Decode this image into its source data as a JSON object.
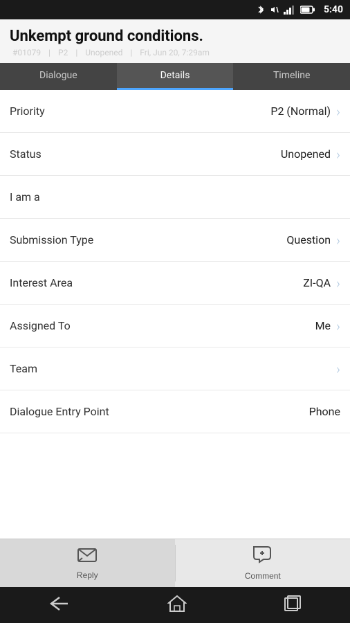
{
  "statusBar": {
    "time": "5:40"
  },
  "header": {
    "title": "Unkempt ground conditions.",
    "id": "#01079",
    "priority": "P2",
    "status": "Unopened",
    "date": "Fri, Jun 20, 7:29am"
  },
  "tabs": [
    {
      "id": "dialogue",
      "label": "Dialogue",
      "active": false
    },
    {
      "id": "details",
      "label": "Details",
      "active": true
    },
    {
      "id": "timeline",
      "label": "Timeline",
      "active": false
    }
  ],
  "details": [
    {
      "id": "priority",
      "label": "Priority",
      "value": "P2 (Normal)",
      "hasChevron": true
    },
    {
      "id": "status",
      "label": "Status",
      "value": "Unopened",
      "hasChevron": true
    },
    {
      "id": "i-am-a",
      "label": "I am a",
      "value": "",
      "hasChevron": false
    },
    {
      "id": "submission-type",
      "label": "Submission Type",
      "value": "Question",
      "hasChevron": true
    },
    {
      "id": "interest-area",
      "label": "Interest Area",
      "value": "ZI-QA",
      "hasChevron": true
    },
    {
      "id": "assigned-to",
      "label": "Assigned To",
      "value": "Me",
      "hasChevron": true
    },
    {
      "id": "team",
      "label": "Team",
      "value": "",
      "hasChevron": true
    },
    {
      "id": "dialogue-entry",
      "label": "Dialogue Entry Point",
      "value": "Phone",
      "hasChevron": false
    }
  ],
  "bottomBar": {
    "replyLabel": "Reply",
    "commentLabel": "Comment"
  },
  "navBar": {
    "backLabel": "back",
    "homeLabel": "home",
    "recentsLabel": "recents"
  }
}
